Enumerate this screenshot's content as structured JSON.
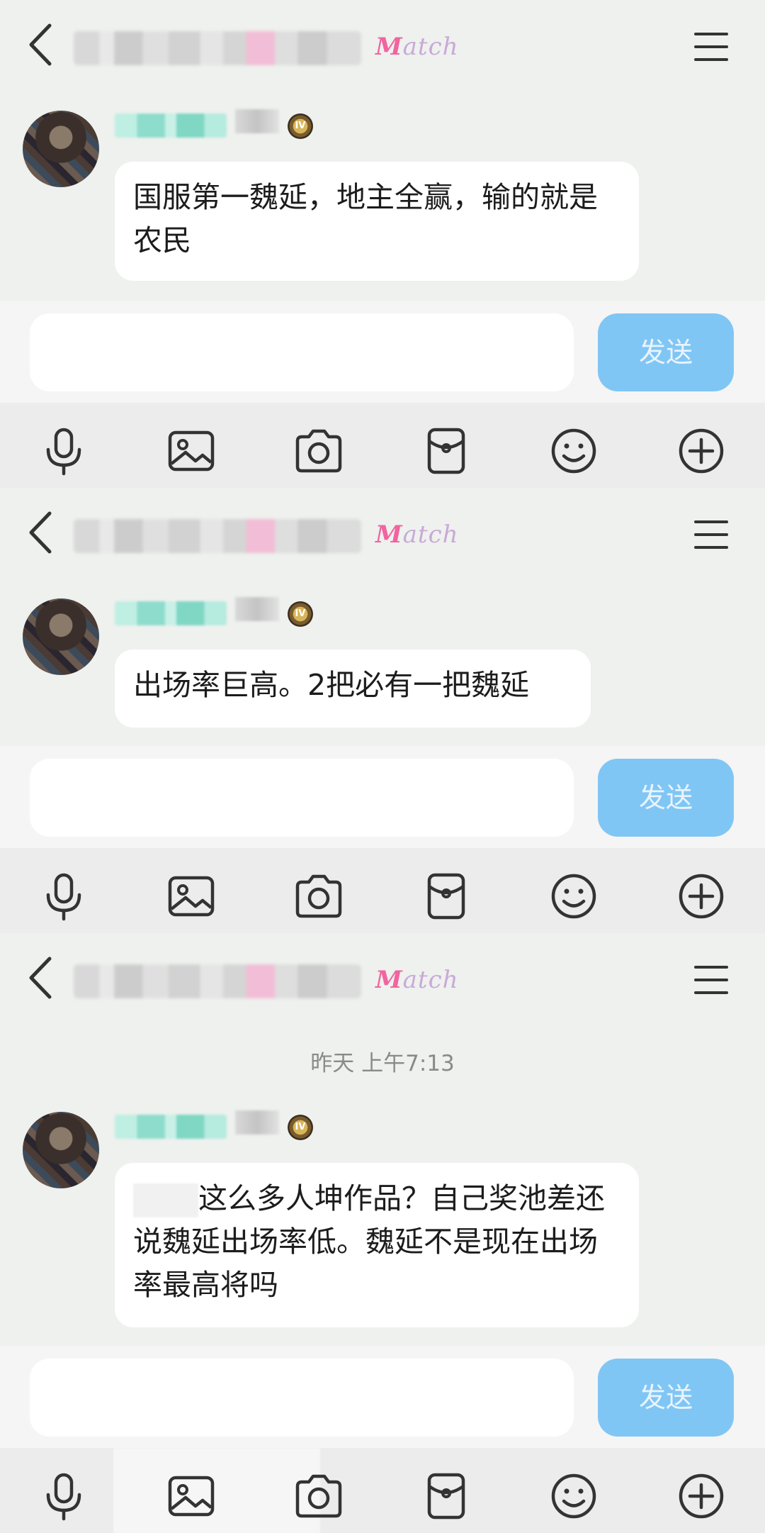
{
  "panels": [
    {
      "message": "国服第一魏延，地主全赢，输的就是农民",
      "send_label": "发送"
    },
    {
      "message": "出场率巨高。2把必有一把魏延",
      "send_label": "发送"
    },
    {
      "timestamp": "昨天 上午7:13",
      "message": "这么多人坤作品？自己奖池差还说魏延出场率低。魏延不是现在出场率最高将吗",
      "send_label": "发送"
    }
  ],
  "header": {
    "logo_text": "Match"
  },
  "badge_text": "IV",
  "toolbar": [
    "microphone-icon",
    "image-icon",
    "camera-icon",
    "red-packet-icon",
    "emoji-icon",
    "plus-icon"
  ]
}
